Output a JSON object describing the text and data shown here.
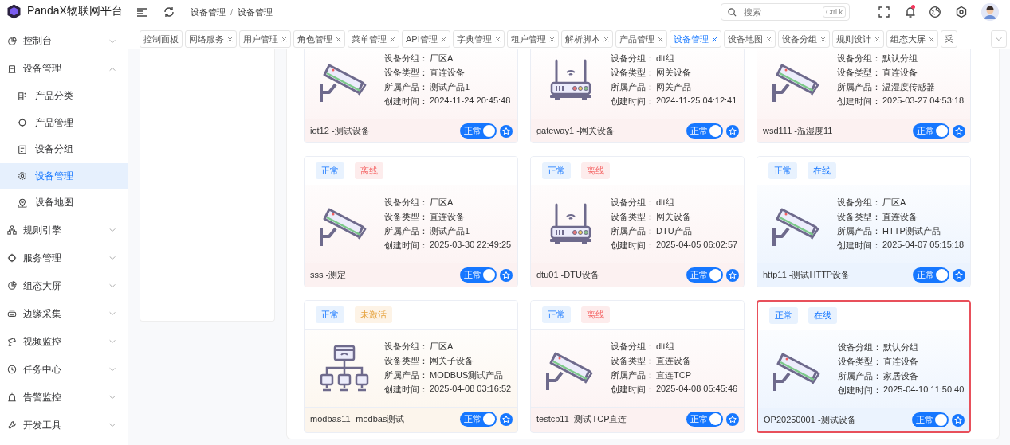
{
  "app": {
    "title": "PandaX物联网平台"
  },
  "sidebar": {
    "items": [
      {
        "label": "控制台",
        "expanded": false
      },
      {
        "label": "设备管理",
        "expanded": true,
        "children": [
          {
            "label": "产品分类",
            "selected": false
          },
          {
            "label": "产品管理",
            "selected": false
          },
          {
            "label": "设备分组",
            "selected": false
          },
          {
            "label": "设备管理",
            "selected": true
          },
          {
            "label": "设备地图",
            "selected": false
          }
        ]
      },
      {
        "label": "规则引擎",
        "expanded": false
      },
      {
        "label": "服务管理",
        "expanded": false
      },
      {
        "label": "组态大屏",
        "expanded": false
      },
      {
        "label": "边缘采集",
        "expanded": false
      },
      {
        "label": "视频监控",
        "expanded": false
      },
      {
        "label": "任务中心",
        "expanded": false
      },
      {
        "label": "告警监控",
        "expanded": false
      },
      {
        "label": "开发工具",
        "expanded": false
      }
    ]
  },
  "header": {
    "breadcrumb": [
      "设备管理",
      "设备管理"
    ],
    "breadcrumb_separator": "/",
    "search": {
      "placeholder": "搜索",
      "shortcut": "Ctrl k"
    },
    "notifications_unread": true
  },
  "tabs": [
    {
      "label": "控制面板",
      "closable": false,
      "selected": false
    },
    {
      "label": "网络服务",
      "closable": true,
      "selected": false
    },
    {
      "label": "用户管理",
      "closable": true,
      "selected": false
    },
    {
      "label": "角色管理",
      "closable": true,
      "selected": false
    },
    {
      "label": "菜单管理",
      "closable": true,
      "selected": false
    },
    {
      "label": "API管理",
      "closable": true,
      "selected": false
    },
    {
      "label": "字典管理",
      "closable": true,
      "selected": false
    },
    {
      "label": "租户管理",
      "closable": true,
      "selected": false
    },
    {
      "label": "解析脚本",
      "closable": true,
      "selected": false
    },
    {
      "label": "产品管理",
      "closable": true,
      "selected": false
    },
    {
      "label": "设备管理",
      "closable": true,
      "selected": true
    },
    {
      "label": "设备地图",
      "closable": true,
      "selected": false
    },
    {
      "label": "设备分组",
      "closable": true,
      "selected": false
    },
    {
      "label": "规则设计",
      "closable": true,
      "selected": false
    },
    {
      "label": "组态大屏",
      "closable": true,
      "selected": false
    },
    {
      "label": "采",
      "closable": false,
      "selected": false
    }
  ],
  "devices": [
    {
      "name": "iot12 -测试设备",
      "kind": "camera",
      "color": "#fcf1f1",
      "selected": false,
      "fields": [
        {
          "label": "设备分组：",
          "value": "厂区A"
        },
        {
          "label": "设备类型：",
          "value": "直连设备"
        },
        {
          "label": "所属产品：",
          "value": "测试产品1"
        },
        {
          "label": "创建时间：",
          "value": "2024-11-24 20:45:48"
        }
      ],
      "switch": {
        "label": "正常",
        "on": true
      }
    },
    {
      "name": "gateway1 -网关设备",
      "kind": "router",
      "color": "#fcf1f1",
      "selected": false,
      "fields": [
        {
          "label": "设备分组：",
          "value": "dlt组"
        },
        {
          "label": "设备类型：",
          "value": "网关设备"
        },
        {
          "label": "所属产品：",
          "value": "网关产品"
        },
        {
          "label": "创建时间：",
          "value": "2024-11-25 04:12:41"
        }
      ],
      "switch": {
        "label": "正常",
        "on": true
      }
    },
    {
      "name": "wsd111 -温湿度11",
      "kind": "camera",
      "color": "#fcf1f1",
      "selected": false,
      "fields": [
        {
          "label": "设备分组：",
          "value": "默认分组"
        },
        {
          "label": "设备类型：",
          "value": "直连设备"
        },
        {
          "label": "所属产品：",
          "value": "温湿度传感器"
        },
        {
          "label": "创建时间：",
          "value": "2025-03-27 04:53:18"
        }
      ],
      "switch": {
        "label": "正常",
        "on": true
      }
    },
    {
      "name": "sss -测定",
      "kind": "camera",
      "color": "#fcf1f1",
      "selected": false,
      "tags": [
        {
          "label": "正常",
          "kind": "normal"
        },
        {
          "label": "离线",
          "kind": "offline"
        }
      ],
      "fields": [
        {
          "label": "设备分组：",
          "value": "厂区A"
        },
        {
          "label": "设备类型：",
          "value": "直连设备"
        },
        {
          "label": "所属产品：",
          "value": "测试产品1"
        },
        {
          "label": "创建时间：",
          "value": "2025-03-30 22:49:25"
        }
      ],
      "switch": {
        "label": "正常",
        "on": true
      }
    },
    {
      "name": "dtu01 -DTU设备",
      "kind": "router",
      "color": "#fcf1f1",
      "selected": false,
      "tags": [
        {
          "label": "正常",
          "kind": "normal"
        },
        {
          "label": "离线",
          "kind": "offline"
        }
      ],
      "fields": [
        {
          "label": "设备分组：",
          "value": "dlt组"
        },
        {
          "label": "设备类型：",
          "value": "网关设备"
        },
        {
          "label": "所属产品：",
          "value": "DTU产品"
        },
        {
          "label": "创建时间：",
          "value": "2025-04-05 06:02:57"
        }
      ],
      "switch": {
        "label": "正常",
        "on": true
      }
    },
    {
      "name": "http11 -测试HTTP设备",
      "kind": "camera",
      "color": "#ebf3fe",
      "selected": false,
      "tags": [
        {
          "label": "正常",
          "kind": "normal"
        },
        {
          "label": "在线",
          "kind": "online"
        }
      ],
      "fields": [
        {
          "label": "设备分组：",
          "value": "厂区A"
        },
        {
          "label": "设备类型：",
          "value": "直连设备"
        },
        {
          "label": "所属产品：",
          "value": "HTTP测试产品"
        },
        {
          "label": "创建时间：",
          "value": "2025-04-07 05:15:18"
        }
      ],
      "switch": {
        "label": "正常",
        "on": true
      }
    },
    {
      "name": "modbas11 -modbas测试",
      "kind": "network",
      "color": "#fcf5ec",
      "selected": false,
      "tags": [
        {
          "label": "正常",
          "kind": "normal"
        },
        {
          "label": "未激活",
          "kind": "inactive"
        }
      ],
      "fields": [
        {
          "label": "设备分组：",
          "value": "厂区A"
        },
        {
          "label": "设备类型：",
          "value": "网关子设备"
        },
        {
          "label": "所属产品：",
          "value": "MODBUS测试产品"
        },
        {
          "label": "创建时间：",
          "value": "2025-04-08 03:16:52"
        }
      ],
      "switch": {
        "label": "正常",
        "on": true
      }
    },
    {
      "name": "testcp11 -测试TCP直连",
      "kind": "camera",
      "color": "#fcf1f1",
      "selected": false,
      "tags": [
        {
          "label": "正常",
          "kind": "normal"
        },
        {
          "label": "离线",
          "kind": "offline"
        }
      ],
      "fields": [
        {
          "label": "设备分组：",
          "value": "dlt组"
        },
        {
          "label": "设备类型：",
          "value": "直连设备"
        },
        {
          "label": "所属产品：",
          "value": "直连TCP"
        },
        {
          "label": "创建时间：",
          "value": "2025-04-08 05:45:46"
        }
      ],
      "switch": {
        "label": "正常",
        "on": true
      }
    },
    {
      "name": "OP20250001 -测试设备",
      "kind": "camera",
      "color": "#ebf3fe",
      "selected": true,
      "tags": [
        {
          "label": "正常",
          "kind": "normal"
        },
        {
          "label": "在线",
          "kind": "online"
        }
      ],
      "fields": [
        {
          "label": "设备分组：",
          "value": "默认分组"
        },
        {
          "label": "设备类型：",
          "value": "直连设备"
        },
        {
          "label": "所属产品：",
          "value": "家居设备"
        },
        {
          "label": "创建时间：",
          "value": "2025-04-10 11:50:40"
        }
      ],
      "switch": {
        "label": "正常",
        "on": true
      }
    }
  ]
}
